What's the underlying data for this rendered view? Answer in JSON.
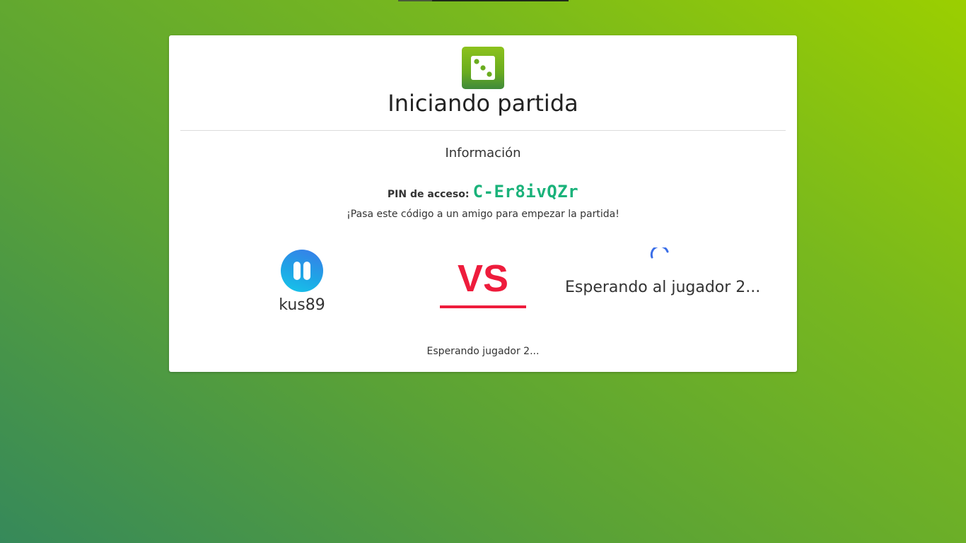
{
  "header": {
    "logo_icon": "dice-icon",
    "title": "Iniciando partida"
  },
  "info": {
    "heading": "Información",
    "pin_label": "PIN de acceso:",
    "pin_code": "C-Er8ivQZr",
    "hint": "¡Pasa este código a un amigo para empezar la partida!"
  },
  "match": {
    "player1": {
      "name": "kus89",
      "avatar_icon": "pause-avatar-icon"
    },
    "vs_label": "VS",
    "player2": {
      "waiting_text": "Esperando al jugador 2...",
      "spinner_icon": "loading-spinner-icon"
    }
  },
  "status": "Esperando jugador 2...",
  "colors": {
    "pin": "#1ab27a",
    "vs": "#ee1c3c",
    "spinner": "#3a6ee8",
    "logo_green": "#8cc21d"
  }
}
